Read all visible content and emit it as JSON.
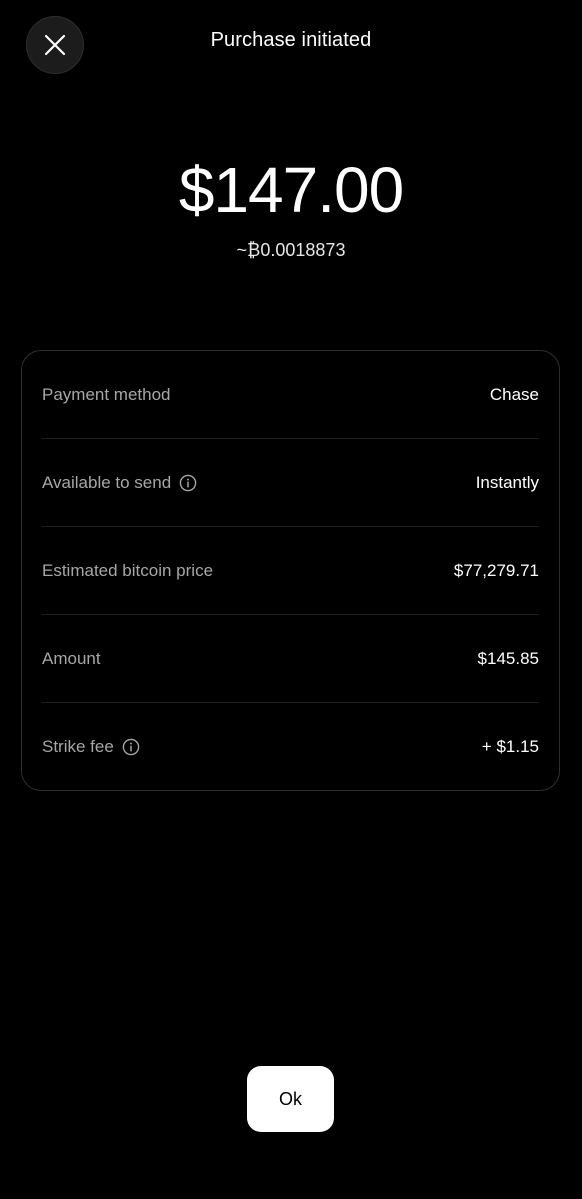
{
  "header": {
    "title": "Purchase initiated",
    "close_icon": "close-icon"
  },
  "summary": {
    "amount_usd": "$147.00",
    "amount_btc": "~₿0.0018873"
  },
  "details": {
    "rows": [
      {
        "label": "Payment method",
        "value": "Chase",
        "has_info": false
      },
      {
        "label": "Available to send",
        "value": "Instantly",
        "has_info": true
      },
      {
        "label": "Estimated bitcoin price",
        "value": "$77,279.71",
        "has_info": false
      },
      {
        "label": "Amount",
        "value": "$145.85",
        "has_info": false
      },
      {
        "label": "Strike fee",
        "value": "+ $1.15",
        "has_info": true
      }
    ]
  },
  "footer": {
    "ok_label": "Ok"
  },
  "colors": {
    "background": "#000000",
    "label": "#a6a6a6",
    "value": "#ffffff",
    "button_bg": "#ffffff",
    "button_text": "#000000",
    "card_border": "#2f2f2f"
  }
}
